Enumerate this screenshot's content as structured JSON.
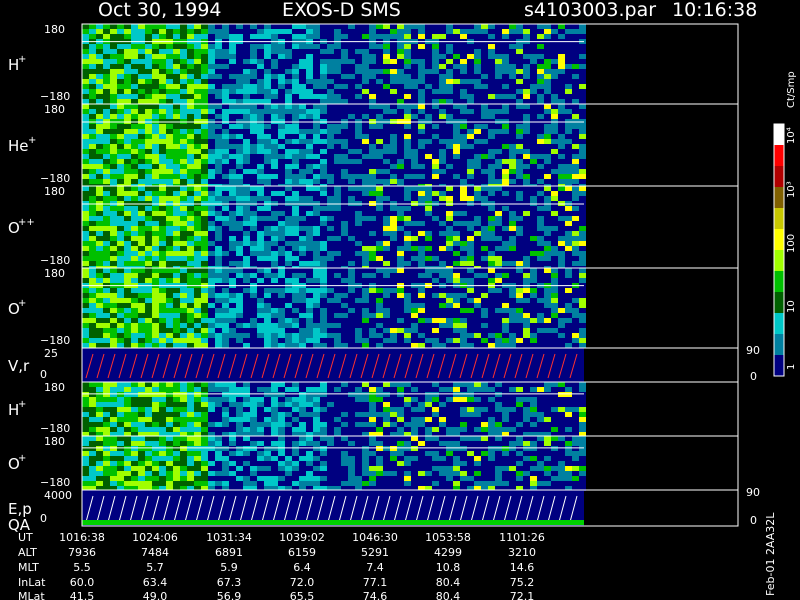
{
  "header": {
    "date": "Oct 30, 1994",
    "instrument": "EXOS-D SMS",
    "file": "s4103003.par",
    "time": "10:16:38"
  },
  "colorbar": {
    "unit": "Ct/Smp",
    "ticks": [
      "10⁴",
      "10³",
      "100",
      "10",
      "1"
    ],
    "colors": [
      "#ffffff",
      "#ff0000",
      "#b00000",
      "#806000",
      "#c8c800",
      "#ffff00",
      "#a0ff00",
      "#00c000",
      "#006000",
      "#00c8c8",
      "#0080a0",
      "#000080"
    ]
  },
  "footer": {
    "stamp": "Feb-01 2AA32L"
  },
  "chart_data": {
    "type": "heatmap",
    "panels": [
      {
        "id": "hplus-1",
        "label": "H",
        "sup": "+",
        "ymax": "180",
        "ymin": "−180",
        "kind": "spectro"
      },
      {
        "id": "heplus",
        "label": "He",
        "sup": "+",
        "ymax": "180",
        "ymin": "−180",
        "kind": "spectro"
      },
      {
        "id": "oplusplus",
        "label": "O",
        "sup": "++",
        "ymax": "180",
        "ymin": "−180",
        "kind": "spectro"
      },
      {
        "id": "oplus-1",
        "label": "O",
        "sup": "+",
        "ymax": "180",
        "ymin": "−180",
        "kind": "spectro"
      },
      {
        "id": "vr",
        "label": "V,r",
        "sup": "",
        "ymax": "25",
        "ymin": "0",
        "rmax": "90",
        "rmin": "0",
        "kind": "line"
      },
      {
        "id": "hplus-2",
        "label": "H",
        "sup": "+",
        "ymax": "180",
        "ymin": "−180",
        "kind": "spectro"
      },
      {
        "id": "oplus-2",
        "label": "O",
        "sup": "+",
        "ymax": "180",
        "ymin": "−180",
        "kind": "spectro"
      },
      {
        "id": "ep",
        "label": "E,p",
        "label2": "QA",
        "sup": "",
        "ymax": "4000",
        "ymin": "0",
        "rmax": "90",
        "rmin": "0",
        "kind": "line"
      }
    ],
    "ephemeris": {
      "row_labels": [
        "UT",
        "ALT",
        "MLT",
        "InLat",
        "MLat"
      ],
      "columns": [
        [
          "1016:38",
          "7936",
          "5.5",
          "60.0",
          "41.5"
        ],
        [
          "1024:06",
          "7484",
          "5.7",
          "63.4",
          "49.0"
        ],
        [
          "1031:34",
          "6891",
          "5.9",
          "67.3",
          "56.9"
        ],
        [
          "1039:02",
          "6159",
          "6.4",
          "72.0",
          "65.5"
        ],
        [
          "1046:30",
          "5291",
          "7.4",
          "77.1",
          "74.6"
        ],
        [
          "1053:58",
          "4299",
          "10.8",
          "80.4",
          "80.4"
        ],
        [
          "1101:26",
          "3210",
          "14.6",
          "75.2",
          "72.1"
        ]
      ]
    }
  }
}
